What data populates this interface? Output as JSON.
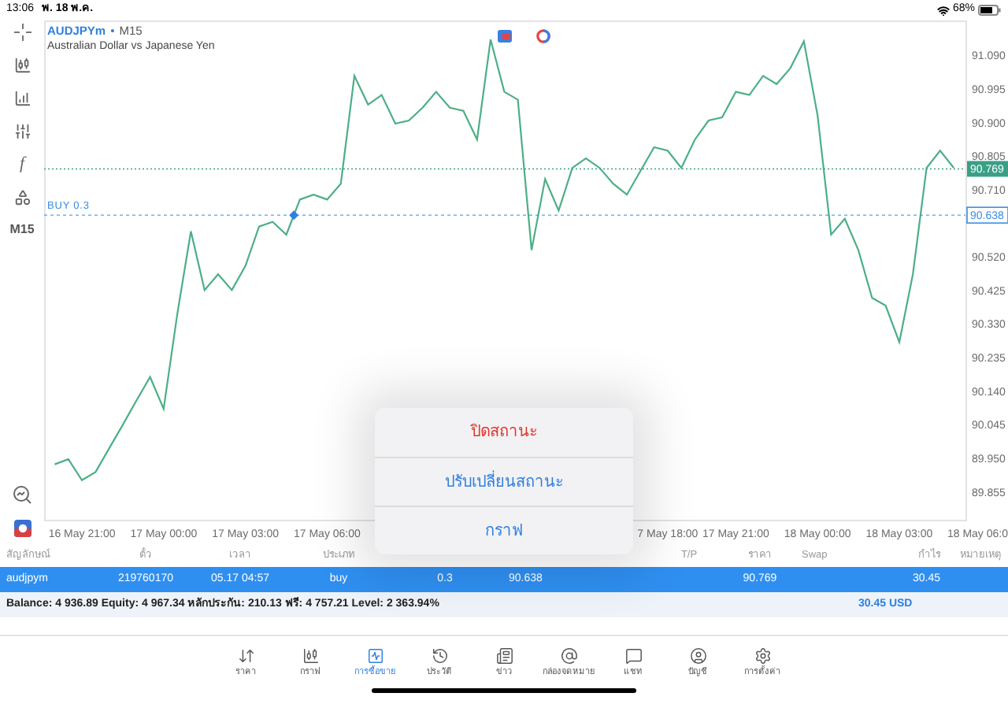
{
  "status_bar": {
    "time": "13:06",
    "date": "พ. 18 พ.ค.",
    "battery": "68%"
  },
  "left_toolbar": {
    "function_label": "f",
    "timeframe": "M15"
  },
  "chart": {
    "symbol": "AUDJPYm",
    "separator": "•",
    "timeframe": "M15",
    "description": "Australian Dollar vs Japanese Yen",
    "chart_data": {
      "type": "line",
      "categories": [
        null,
        null,
        "16 May 21:00",
        null,
        null,
        null,
        null,
        null,
        "17 May 00:00",
        null,
        null,
        null,
        null,
        null,
        "17 May 03:00",
        null,
        null,
        null,
        null,
        null,
        "17 May 06:00",
        null,
        null,
        null,
        null,
        null,
        null,
        null,
        null,
        null,
        null,
        null,
        null,
        null,
        null,
        null,
        null,
        null,
        null,
        null,
        null,
        null,
        null,
        null,
        null,
        "7 May 18:00",
        null,
        null,
        null,
        null,
        "17 May 21:00",
        null,
        null,
        null,
        null,
        null,
        "18 May 00:00",
        null,
        null,
        null,
        null,
        null,
        "18 May 03:00",
        null,
        null,
        null,
        null,
        null,
        "18 May 06:0"
      ],
      "series": [
        {
          "color": "#4caf86",
          "values": [
            89.933,
            89.947,
            89.888,
            89.911,
            89.978,
            90.045,
            90.113,
            90.18,
            90.09,
            90.359,
            90.592,
            90.426,
            90.471,
            90.426,
            90.494,
            90.606,
            90.619,
            90.583,
            90.682,
            90.696,
            90.682,
            90.727,
            91.032,
            90.951,
            90.978,
            90.897,
            90.906,
            90.942,
            90.987,
            90.942,
            90.933,
            90.852,
            91.135,
            90.987,
            90.965,
            90.539,
            90.74,
            90.651,
            90.772,
            90.799,
            90.772,
            90.727,
            90.696,
            90.763,
            90.83,
            90.821,
            90.772,
            90.852,
            90.906,
            90.915,
            90.987,
            90.978,
            91.032,
            91.009,
            91.054,
            91.13,
            90.92,
            90.583,
            90.628,
            90.539,
            90.404,
            90.382,
            90.279,
            90.471,
            90.772,
            90.821,
            90.772,
            null,
            null
          ]
        }
      ],
      "ylim": [
        89.776,
        91.189
      ],
      "yticks": [
        {
          "value": 89.855,
          "label": "89.855"
        },
        {
          "value": 89.95,
          "label": "89.950"
        },
        {
          "value": 90.045,
          "label": "90.045"
        },
        {
          "value": 90.14,
          "label": "90.140"
        },
        {
          "value": 90.235,
          "label": "90.235"
        },
        {
          "value": 90.33,
          "label": "90.330"
        },
        {
          "value": 90.425,
          "label": "90.425"
        },
        {
          "value": 90.52,
          "label": "90.520"
        },
        {
          "value": 90.71,
          "label": "90.710"
        },
        {
          "value": 90.805,
          "label": "90.805"
        },
        {
          "value": 90.9,
          "label": "90.900"
        },
        {
          "value": 90.995,
          "label": "90.995"
        },
        {
          "value": 91.09,
          "label": "91.090"
        }
      ],
      "ref_lines": [
        {
          "axis": "y",
          "value": 90.769,
          "label": "90.769",
          "color": "#3a9f86"
        },
        {
          "axis": "y",
          "value": 90.638,
          "label": "90.638",
          "color": "#3a8ee0"
        }
      ],
      "annotations": [
        "BUY 0.3"
      ]
    }
  },
  "positions_table": {
    "columns": [
      "สัญลักษณ์",
      "ตั๋ว",
      "เวลา",
      "ประเภท",
      "",
      "",
      "",
      "T/P",
      "ราคา",
      "Swap",
      "กำไร",
      "หมายเหตุ"
    ],
    "rows": [
      {
        "selected": true,
        "cells": [
          "audjpym",
          "219760170",
          "05.17 04:57",
          "buy",
          "0.3",
          "90.638",
          "",
          "",
          "90.769",
          "",
          "30.45",
          ""
        ]
      }
    ],
    "summary": {
      "text": "Balance: 4 936.89 Equity: 4 967.34 หลักประกัน: 210.13 ฟรี: 4 757.21 Level: 2 363.94%",
      "total": "30.45 USD"
    }
  },
  "action_sheet": {
    "items": [
      {
        "label": "ปิดสถานะ",
        "kind": "destructive"
      },
      {
        "label": "ปรับเปลี่ยนสถานะ",
        "kind": "default"
      },
      {
        "label": "กราฟ",
        "kind": "default"
      }
    ]
  },
  "tab_bar": {
    "tabs": [
      {
        "label": "ราคา",
        "selected": false
      },
      {
        "label": "กราฟ",
        "selected": false
      },
      {
        "label": "การซื้อขาย",
        "selected": true
      },
      {
        "label": "ประวัติ",
        "selected": false
      },
      {
        "label": "ข่าว",
        "selected": false
      },
      {
        "label": "กล่องจดหมาย",
        "selected": false
      },
      {
        "label": "แชท",
        "selected": false
      },
      {
        "label": "บัญชี",
        "selected": false
      },
      {
        "label": "การตั้งค่า",
        "selected": false
      }
    ]
  }
}
